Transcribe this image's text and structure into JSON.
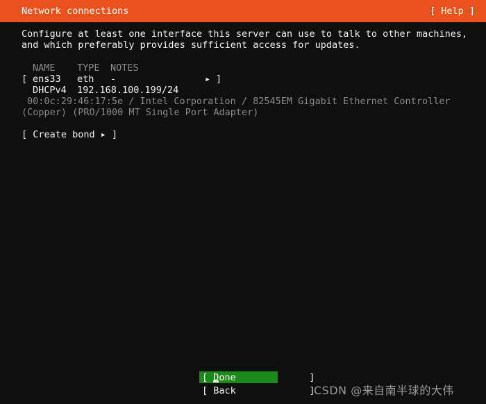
{
  "header": {
    "title": "Network connections",
    "help_label": "[ Help ]",
    "bg_color": "#e8521f",
    "fg_color": "#ffffff"
  },
  "description": {
    "line1": "Configure at least one interface this server can use to talk to other machines,",
    "line2": "and which preferably provides sufficient access for updates."
  },
  "table": {
    "columns": [
      "NAME",
      "TYPE",
      "NOTES"
    ],
    "rows": [
      {
        "bracket_open": "[",
        "name": "ens33",
        "type": "eth",
        "notes": "-",
        "arrow": "▸",
        "bracket_close": "]",
        "dhcp_label": "DHCPv4",
        "dhcp_value": "192.168.100.199/24",
        "hardware_line1": "00:0c:29:46:17:5e / Intel Corporation / 82545EM Gigabit Ethernet Controller",
        "hardware_line2": "(Copper) (PRO/1000 MT Single Port Adapter)"
      }
    ]
  },
  "actions": {
    "create_bond": "[ Create bond ▸ ]"
  },
  "footer": {
    "done_label": "[ Done             ]",
    "back_label": "[ Back             ]",
    "done_selected_color": "#1a8a1a"
  },
  "watermark": {
    "text": "CSDN @来自南半球的大伟"
  }
}
